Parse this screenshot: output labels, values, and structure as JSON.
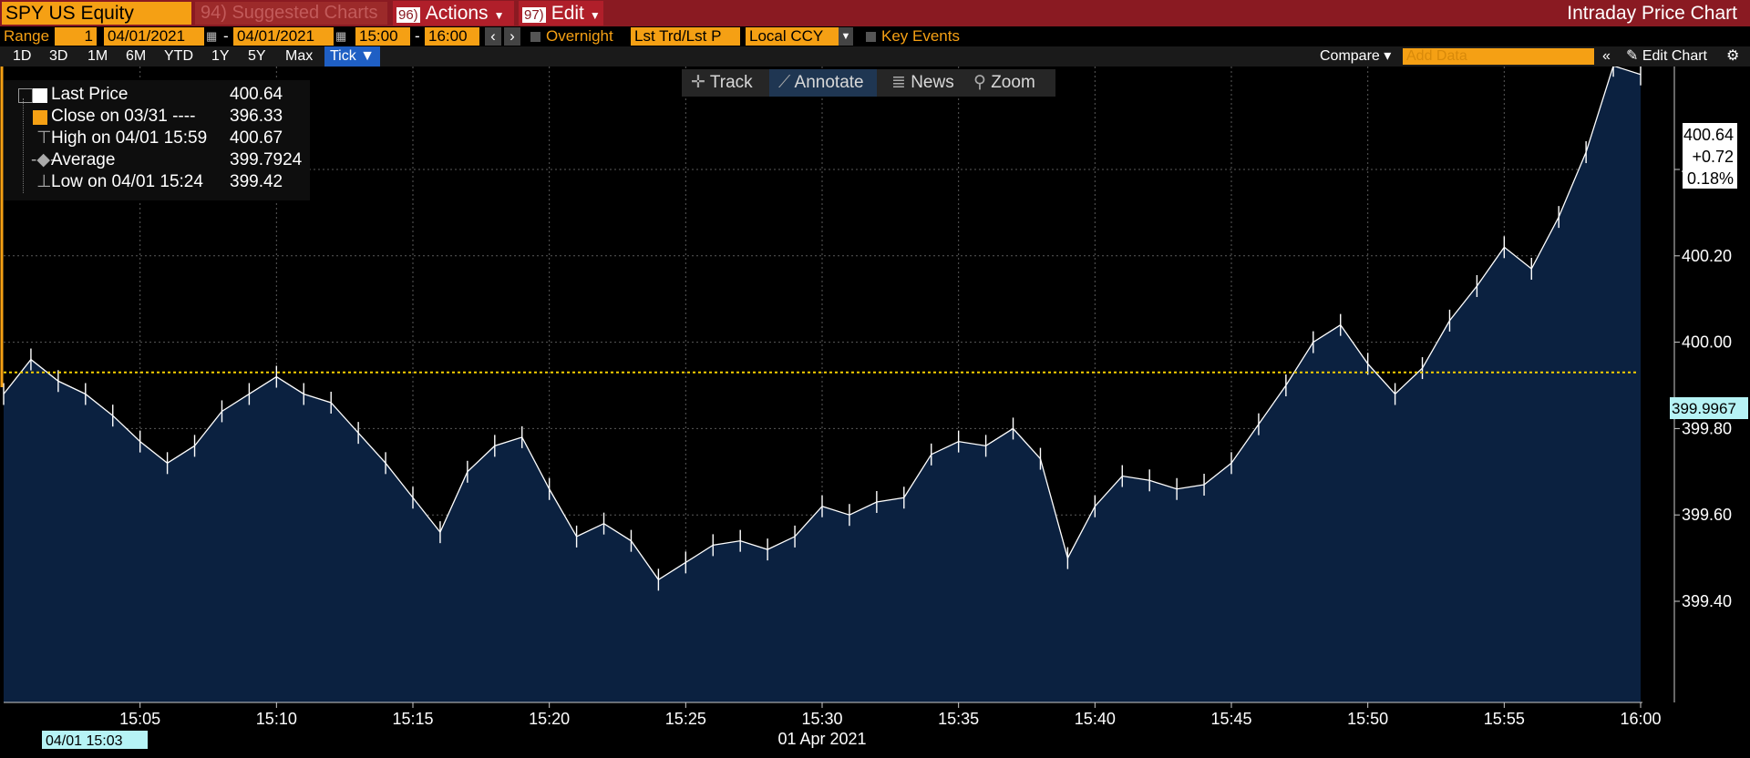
{
  "header": {
    "ticker": "SPY US Equity",
    "suggested": "94) Suggested Charts",
    "actions_num": "96)",
    "actions_label": "Actions",
    "edit_num": "97)",
    "edit_label": "Edit",
    "window_title": "Intraday Price Chart"
  },
  "controls": {
    "range_label": "Range",
    "range_value": "1",
    "start_date": "04/01/2021",
    "dash1": "-",
    "end_date": "04/01/2021",
    "start_time": "15:00",
    "dash2": "-",
    "end_time": "16:00",
    "overnight": "Overnight",
    "price_type": "Lst Trd/Lst P",
    "currency": "Local CCY",
    "key_events": "Key Events"
  },
  "periods": [
    "1D",
    "3D",
    "1M",
    "6M",
    "YTD",
    "1Y",
    "5Y",
    "Max"
  ],
  "tick_label": "Tick ▼",
  "compare_label": "Compare ▾",
  "add_data_placeholder": "Add Data",
  "edit_chart_label": "Edit Chart",
  "toolbar": {
    "track": "Track",
    "annotate": "Annotate",
    "news": "News",
    "zoom": "Zoom"
  },
  "legend": [
    {
      "label": "Last Price",
      "value": "400.64"
    },
    {
      "label": "Close on 03/31 ---- ",
      "value": "396.33"
    },
    {
      "label": "High on 04/01 15:59",
      "value": "400.67"
    },
    {
      "label": "Average",
      "value": "399.7924"
    },
    {
      "label": "Low on 04/01 15:24",
      "value": "399.42"
    }
  ],
  "colors": {
    "header_red": "#8a1a22",
    "amber": "#f5a014",
    "area_fill": "#0b2140",
    "price_line": "#ffffff",
    "average_line": "#f5d000",
    "crosshair_label": "#b6f3f5"
  },
  "chart_data": {
    "type": "line",
    "title": "",
    "xlabel": "01 Apr 2021",
    "ylabel": "",
    "x_range": [
      "15:00",
      "16:00"
    ],
    "ylim": [
      399.33,
      400.67
    ],
    "x_ticks": [
      "15:05",
      "15:10",
      "15:15",
      "15:20",
      "15:25",
      "15:30",
      "15:35",
      "15:40",
      "15:45",
      "15:50",
      "15:55",
      "16:00"
    ],
    "y_ticks": [
      "399.40",
      "399.60",
      "399.80",
      "400.00",
      "400.20",
      "400.40"
    ],
    "y_tick_values": [
      399.4,
      399.6,
      399.8,
      400.0,
      400.2,
      400.4
    ],
    "grid": true,
    "average": 399.7924,
    "average_label": "399.9967",
    "last_price_label": "400.64",
    "change": "+0.72",
    "change_pct": "0.18%",
    "cursor_time": "04/01 15:03",
    "series": [
      {
        "x": [
          "15:00",
          "15:01",
          "15:02",
          "15:03",
          "15:04",
          "15:05",
          "15:06",
          "15:07",
          "15:08",
          "15:09",
          "15:10",
          "15:11",
          "15:12",
          "15:13",
          "15:14",
          "15:15",
          "15:16",
          "15:17",
          "15:18",
          "15:19",
          "15:20",
          "15:21",
          "15:22",
          "15:23",
          "15:24",
          "15:25",
          "15:26",
          "15:27",
          "15:28",
          "15:29",
          "15:30",
          "15:31",
          "15:32",
          "15:33",
          "15:34",
          "15:35",
          "15:36",
          "15:37",
          "15:38",
          "15:39",
          "15:40",
          "15:41",
          "15:42",
          "15:43",
          "15:44",
          "15:45",
          "15:46",
          "15:47",
          "15:48",
          "15:49",
          "15:50",
          "15:51",
          "15:52",
          "15:53",
          "15:54",
          "15:55",
          "15:56",
          "15:57",
          "15:58",
          "15:59",
          "16:00"
        ],
        "y": [
          399.88,
          399.96,
          399.91,
          399.88,
          399.83,
          399.77,
          399.72,
          399.76,
          399.84,
          399.88,
          399.92,
          399.88,
          399.86,
          399.79,
          399.72,
          399.64,
          399.56,
          399.7,
          399.76,
          399.78,
          399.66,
          399.55,
          399.58,
          399.54,
          399.45,
          399.49,
          399.53,
          399.54,
          399.52,
          399.55,
          399.62,
          399.6,
          399.63,
          399.64,
          399.74,
          399.77,
          399.76,
          399.8,
          399.73,
          399.5,
          399.62,
          399.69,
          399.68,
          399.66,
          399.67,
          399.72,
          399.81,
          399.9,
          400.0,
          400.04,
          399.95,
          399.88,
          399.94,
          400.05,
          400.13,
          400.22,
          400.17,
          400.29,
          400.44,
          400.64,
          400.62
        ]
      }
    ]
  }
}
